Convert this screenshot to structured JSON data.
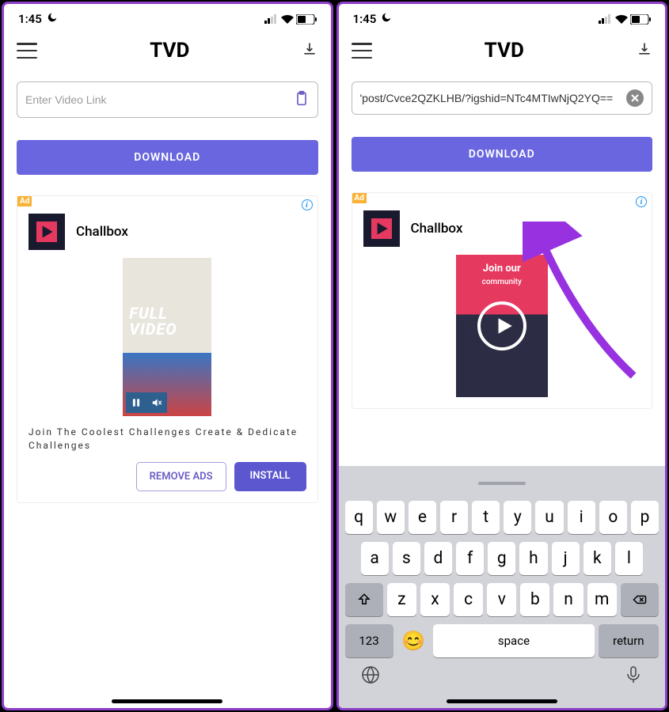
{
  "status": {
    "time": "1:45"
  },
  "nav": {
    "title": "TVD"
  },
  "input": {
    "placeholder": "Enter Video Link",
    "filled_value": "'post/Cvce2QZKLHB/?igshid=NTc4MTIwNjQ2YQ=="
  },
  "download_label": "DOWNLOAD",
  "ad": {
    "badge": "Ad",
    "name": "Challbox",
    "video_text_line1": "FULL",
    "video_text_line2": "VIDEO",
    "description": "Join The Coolest Challenges Create & Dedicate Challenges",
    "remove_label": "REMOVE ADS",
    "install_label": "INSTALL",
    "video2_line1": "Join our",
    "video2_line2": "community"
  },
  "keyboard": {
    "row1": [
      "q",
      "w",
      "e",
      "r",
      "t",
      "y",
      "u",
      "i",
      "o",
      "p"
    ],
    "row2": [
      "a",
      "s",
      "d",
      "f",
      "g",
      "h",
      "j",
      "k",
      "l"
    ],
    "row3": [
      "z",
      "x",
      "c",
      "v",
      "b",
      "n",
      "m"
    ],
    "num": "123",
    "space": "space",
    "return": "return"
  }
}
